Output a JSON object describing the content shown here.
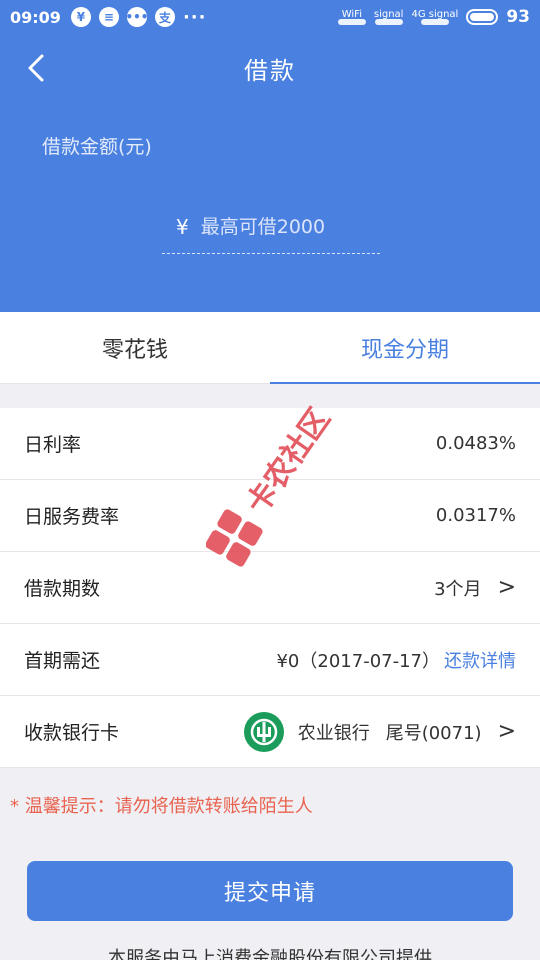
{
  "status_bar": {
    "time": "09:09",
    "icons": [
      "pay-icon",
      "message-icon",
      "chat-icon",
      "alipay-icon",
      "more-icon"
    ],
    "wifi_label": "WiFi",
    "signal_label": "signal",
    "signal2_label": "4G signal",
    "battery": "93"
  },
  "nav": {
    "title": "借款"
  },
  "loan": {
    "amount_label": "借款金额(元)",
    "currency_symbol": "¥",
    "amount_placeholder": "最高可借2000"
  },
  "tabs": [
    {
      "label": "零花钱",
      "active": false
    },
    {
      "label": "现金分期",
      "active": true
    }
  ],
  "details": {
    "daily_rate": {
      "label": "日利率",
      "value": "0.0483%"
    },
    "service_rate": {
      "label": "日服务费率",
      "value": "0.0317%"
    },
    "term": {
      "label": "借款期数",
      "value": "3个月"
    },
    "first_repay": {
      "label": "首期需还",
      "value": "¥0（2017-07-17）",
      "link": "还款详情"
    },
    "bank_card": {
      "label": "收款银行卡",
      "bank": "农业银行",
      "tail": "尾号(0071)"
    }
  },
  "tip": "* 温馨提示：请勿将借款转账给陌生人",
  "submit_label": "提交申请",
  "footer_text": "本服务由马上消费金融股份有限公司提供",
  "watermark_text": "卡农社区",
  "colors": {
    "primary": "#4a80e0",
    "tip_red": "#e96450",
    "bank_green": "#1b9c5a",
    "watermark_red": "#e0434d"
  }
}
